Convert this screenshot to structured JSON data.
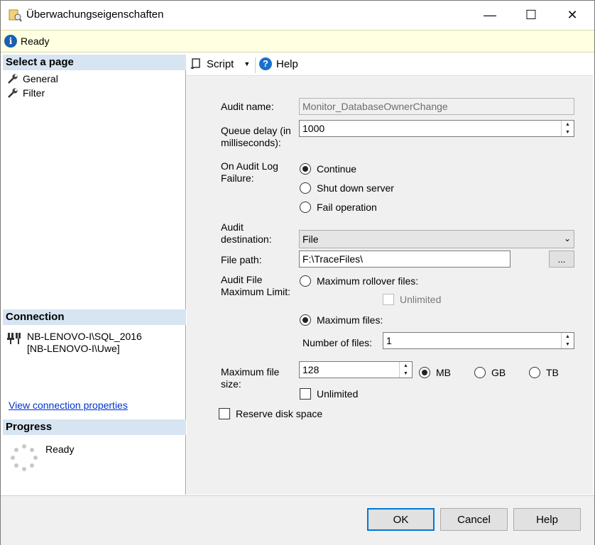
{
  "window": {
    "title": "Überwachungseigenschaften",
    "minimize": "—",
    "maximize": "☐",
    "close": "✕"
  },
  "status": {
    "text": "Ready"
  },
  "left": {
    "select_page_header": "Select a page",
    "pages": [
      {
        "label": "General",
        "icon": "wrench-icon"
      },
      {
        "label": "Filter",
        "icon": "wrench-icon"
      }
    ],
    "connection_header": "Connection",
    "connection_line1": "NB-LENOVO-I\\SQL_2016",
    "connection_line2": "[NB-LENOVO-I\\Uwe]",
    "view_connection": "View connection properties",
    "progress_header": "Progress",
    "progress_status": "Ready"
  },
  "toolbar": {
    "script": "Script",
    "help": "Help"
  },
  "form": {
    "audit_name_label": "Audit name:",
    "audit_name_value": "Monitor_DatabaseOwnerChange",
    "queue_delay_label_1": "Queue delay (in",
    "queue_delay_label_2": "milliseconds):",
    "queue_delay_value": "1000",
    "on_failure_label_1": "On Audit Log",
    "on_failure_label_2": "Failure:",
    "opt_continue": "Continue",
    "opt_shutdown": "Shut down server",
    "opt_fail": "Fail operation",
    "destination_label_1": "Audit",
    "destination_label_2": "destination:",
    "destination_value": "File",
    "file_path_label": "File path:",
    "file_path_value": "F:\\TraceFiles\\",
    "browse": "...",
    "max_limit_label_1": "Audit File",
    "max_limit_label_2": "Maximum Limit:",
    "opt_max_rollover": "Maximum rollover files:",
    "unlimited_rollover": "Unlimited",
    "opt_max_files": "Maximum files:",
    "num_files_label": "Number of files:",
    "num_files_value": "1",
    "max_file_size_label_1": "Maximum file",
    "max_file_size_label_2": "size:",
    "max_file_size_value": "128",
    "unit_mb": "MB",
    "unit_gb": "GB",
    "unit_tb": "TB",
    "unlimited_size": "Unlimited",
    "reserve_disk": "Reserve disk space"
  },
  "buttons": {
    "ok": "OK",
    "cancel": "Cancel",
    "help": "Help"
  }
}
